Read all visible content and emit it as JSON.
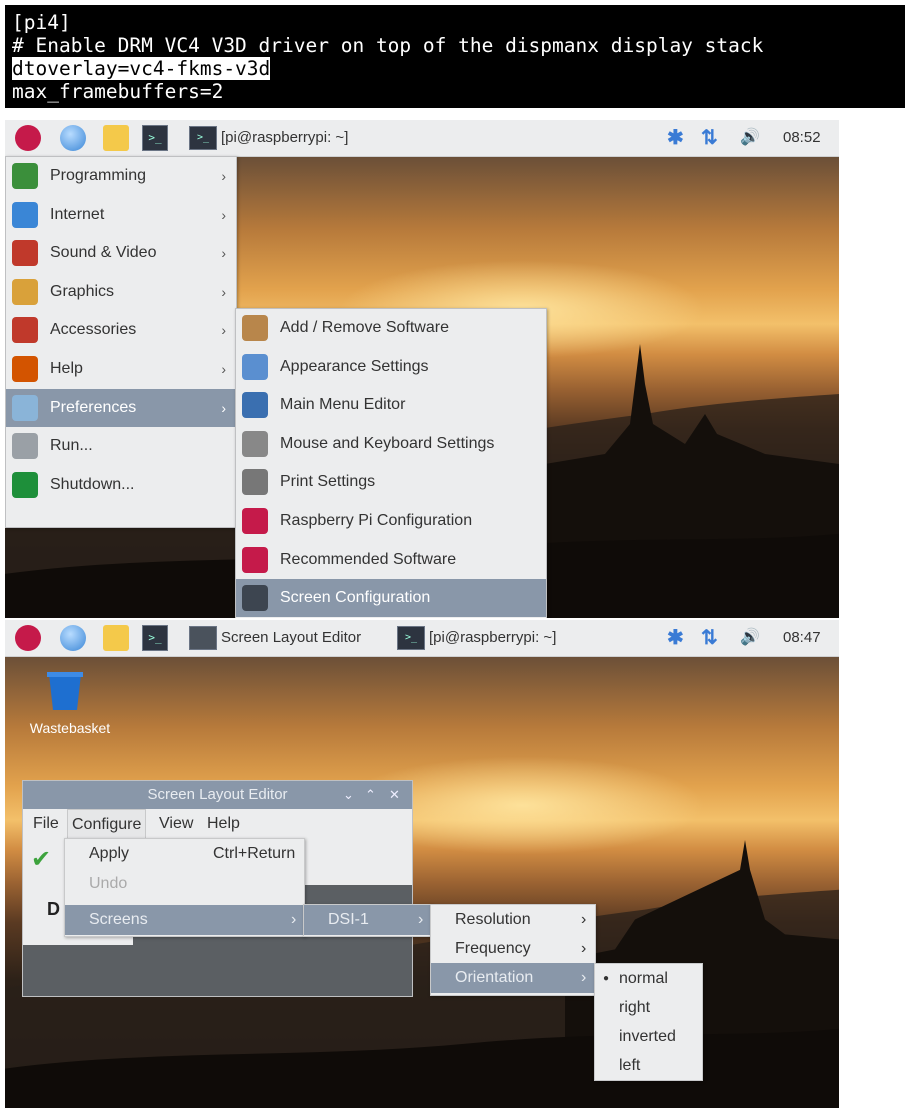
{
  "terminal": {
    "lines": [
      "[pi4]",
      "# Enable DRM VC4 V3D driver on top of the dispmanx display stack",
      "dtoverlay=vc4-fkms-v3d",
      "max_framebuffers=2"
    ]
  },
  "shot1": {
    "taskbar": {
      "task_label": "[pi@raspberrypi: ~]",
      "clock": "08:52"
    },
    "main_menu": [
      {
        "label": "Programming",
        "icon": "programming-icon",
        "color": "#3b8f3b"
      },
      {
        "label": "Internet",
        "icon": "internet-icon",
        "color": "#3a86d6"
      },
      {
        "label": "Sound & Video",
        "icon": "sound-video-icon",
        "color": "#c0392b"
      },
      {
        "label": "Graphics",
        "icon": "graphics-icon",
        "color": "#d9a13a"
      },
      {
        "label": "Accessories",
        "icon": "accessories-icon",
        "color": "#c0392b"
      },
      {
        "label": "Help",
        "icon": "help-icon",
        "color": "#d35400"
      },
      {
        "label": "Preferences",
        "icon": "preferences-icon",
        "color": "#8ab4d8",
        "selected": true
      },
      {
        "label": "Run...",
        "icon": "run-icon",
        "color": "#9aa0a6"
      },
      {
        "label": "Shutdown...",
        "icon": "shutdown-icon",
        "color": "#1e8f3a"
      }
    ],
    "preferences_menu": [
      {
        "label": "Add / Remove Software",
        "icon": "add-remove-software-icon",
        "color": "#b8864b"
      },
      {
        "label": "Appearance Settings",
        "icon": "appearance-settings-icon",
        "color": "#5a8fd0"
      },
      {
        "label": "Main Menu Editor",
        "icon": "main-menu-editor-icon",
        "color": "#3a6fb0"
      },
      {
        "label": "Mouse and Keyboard Settings",
        "icon": "mouse-keyboard-icon",
        "color": "#888888"
      },
      {
        "label": "Print Settings",
        "icon": "printer-icon",
        "color": "#777777"
      },
      {
        "label": "Raspberry Pi Configuration",
        "icon": "raspberry-pi-icon",
        "color": "#c51a4a"
      },
      {
        "label": "Recommended Software",
        "icon": "raspberry-pi-icon",
        "color": "#c51a4a"
      },
      {
        "label": "Screen Configuration",
        "icon": "monitor-icon",
        "color": "#3d4550",
        "selected": true
      }
    ]
  },
  "shot2": {
    "taskbar": {
      "task1_label": "Screen Layout Editor",
      "task2_label": "[pi@raspberrypi: ~]",
      "clock": "08:47"
    },
    "desktop_icon": "Wastebasket",
    "window": {
      "title": "Screen Layout Editor",
      "menubar": [
        "File",
        "Configure",
        "View",
        "Help"
      ],
      "toolbar_letter": "D"
    },
    "configure_menu": [
      {
        "label": "Apply",
        "shortcut": "Ctrl+Return"
      },
      {
        "label": "Undo",
        "disabled": true
      },
      {
        "label": "Screens",
        "selected": true
      }
    ],
    "screens_menu": [
      {
        "label": "DSI-1",
        "selected": true
      }
    ],
    "dsi_menu": [
      {
        "label": "Resolution"
      },
      {
        "label": "Frequency"
      },
      {
        "label": "Orientation",
        "selected": true
      }
    ],
    "orientation_menu": [
      {
        "label": "normal",
        "checked": true
      },
      {
        "label": "right"
      },
      {
        "label": "inverted"
      },
      {
        "label": "left"
      }
    ]
  }
}
